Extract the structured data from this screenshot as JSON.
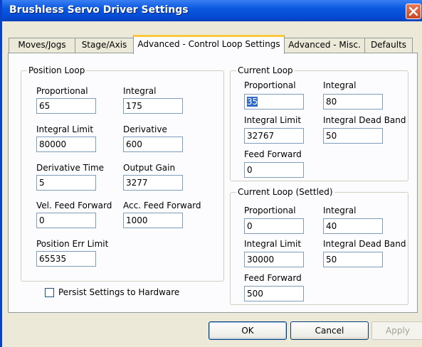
{
  "window": {
    "title": "Brushless Servo Driver Settings"
  },
  "tabs": [
    {
      "label": "Moves/Jogs"
    },
    {
      "label": "Stage/Axis"
    },
    {
      "label": "Advanced - Control Loop Settings"
    },
    {
      "label": "Advanced - Misc."
    },
    {
      "label": "Defaults"
    }
  ],
  "position_loop": {
    "title": "Position Loop",
    "proportional_label": "Proportional",
    "proportional": "65",
    "integral_label": "Integral",
    "integral": "175",
    "integral_limit_label": "Integral Limit",
    "integral_limit": "80000",
    "derivative_label": "Derivative",
    "derivative": "600",
    "derivative_time_label": "Derivative Time",
    "derivative_time": "5",
    "output_gain_label": "Output Gain",
    "output_gain": "3277",
    "vel_ff_label": "Vel. Feed Forward",
    "vel_ff": "0",
    "acc_ff_label": "Acc. Feed Forward",
    "acc_ff": "1000",
    "pos_err_label": "Position Err Limit",
    "pos_err": "65535"
  },
  "current_loop": {
    "title": "Current Loop",
    "proportional_label": "Proportional",
    "proportional": "35",
    "integral_label": "Integral",
    "integral": "80",
    "integral_limit_label": "Integral Limit",
    "integral_limit": "32767",
    "dead_band_label": "Integral Dead Band",
    "dead_band": "50",
    "feed_forward_label": "Feed Forward",
    "feed_forward": "0"
  },
  "current_loop_settled": {
    "title": "Current Loop (Settled)",
    "proportional_label": "Proportional",
    "proportional": "0",
    "integral_label": "Integral",
    "integral": "40",
    "integral_limit_label": "Integral Limit",
    "integral_limit": "30000",
    "dead_band_label": "Integral Dead Band",
    "dead_band": "50",
    "feed_forward_label": "Feed Forward",
    "feed_forward": "500"
  },
  "persist": {
    "label": "Persist Settings to Hardware",
    "checked": false
  },
  "buttons": {
    "ok": "OK",
    "cancel": "Cancel",
    "apply": "Apply"
  },
  "icons": {
    "close": "close-icon"
  },
  "colors": {
    "titlebar": "#0A58E0",
    "tab_highlight": "#FFC83C",
    "selection": "#316AC5"
  }
}
